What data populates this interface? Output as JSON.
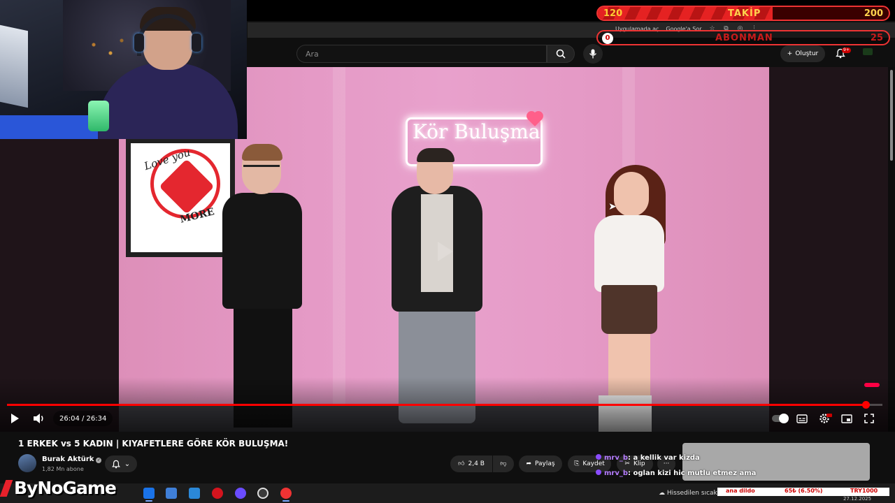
{
  "browser": {
    "actions": [
      "Uygulamada aç",
      "Google'a Sor"
    ]
  },
  "header": {
    "search_placeholder": "Ara",
    "create_label": "Oluştur",
    "notification_count": "9+"
  },
  "overlay": {
    "follow": {
      "current": "120",
      "label": "TAKİP",
      "goal": "200",
      "progress": 0.6,
      "color": "#e52222"
    },
    "subscriber": {
      "current": "0",
      "label": "ABONMAN",
      "goal": "25",
      "progress": 0.0
    }
  },
  "video": {
    "neon_sign": "Kör Buluşma",
    "poster_top": "Love you",
    "poster_bottom": "MORE",
    "current_time": "26:04",
    "duration": "26:34",
    "time_display": "26:04 / 26:34",
    "progress": 0.981
  },
  "details": {
    "title": "1 ERKEK vs 5 KADIN | KIYAFETLERE GÖRE KÖR BULUŞMA!",
    "channel": "Burak Aktürk",
    "subscribers": "1,82 Mn abone",
    "likes": "2,4 B",
    "share_label": "Paylaş",
    "save_label": "Kaydet",
    "clip_label": "Klip",
    "more_label": "···"
  },
  "chat": [
    {
      "user": "mrv_b",
      "text": ": a kellik var kizda"
    },
    {
      "user": "mrv_b",
      "text": ": oglan kizi hic mutlu etmez ama"
    }
  ],
  "taskbar": {
    "logo": "ByNoGame",
    "weather": "Hissedilen sıcak",
    "ticker": [
      "ana dildo",
      "65₺ (6.50%)",
      "TRY1000"
    ],
    "date": "27.12.2025"
  },
  "colors": {
    "accent": "#ff0000",
    "follow_bar": "#e52222",
    "chat_user": "#b57dff"
  }
}
